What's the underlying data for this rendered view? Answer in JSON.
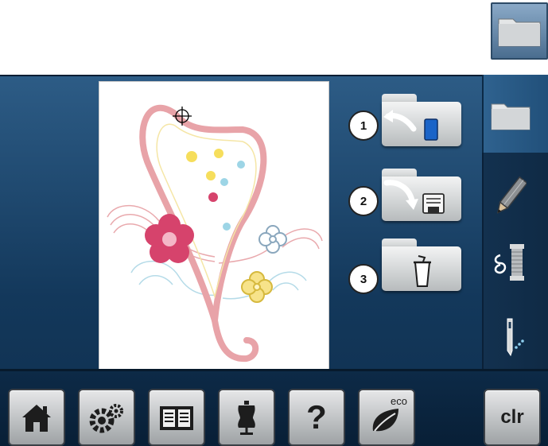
{
  "bottom_bar": {
    "help_label": "?",
    "eco_label": "eco",
    "clear_label": "clr"
  },
  "actions": [
    {
      "number": "1",
      "icon": "load-from-machine-icon"
    },
    {
      "number": "2",
      "icon": "save-to-memory-icon"
    },
    {
      "number": "3",
      "icon": "delete-trash-icon"
    }
  ],
  "right_tabs": [
    "folder-icon",
    "pencil-icon",
    "thread-spool-icon",
    "needle-icon"
  ],
  "colors": {
    "screen_blue": "#1b4670",
    "button_gray": "#c7cacb",
    "heart_pink": "#e8a3a8",
    "flower_magenta": "#d6436c"
  }
}
